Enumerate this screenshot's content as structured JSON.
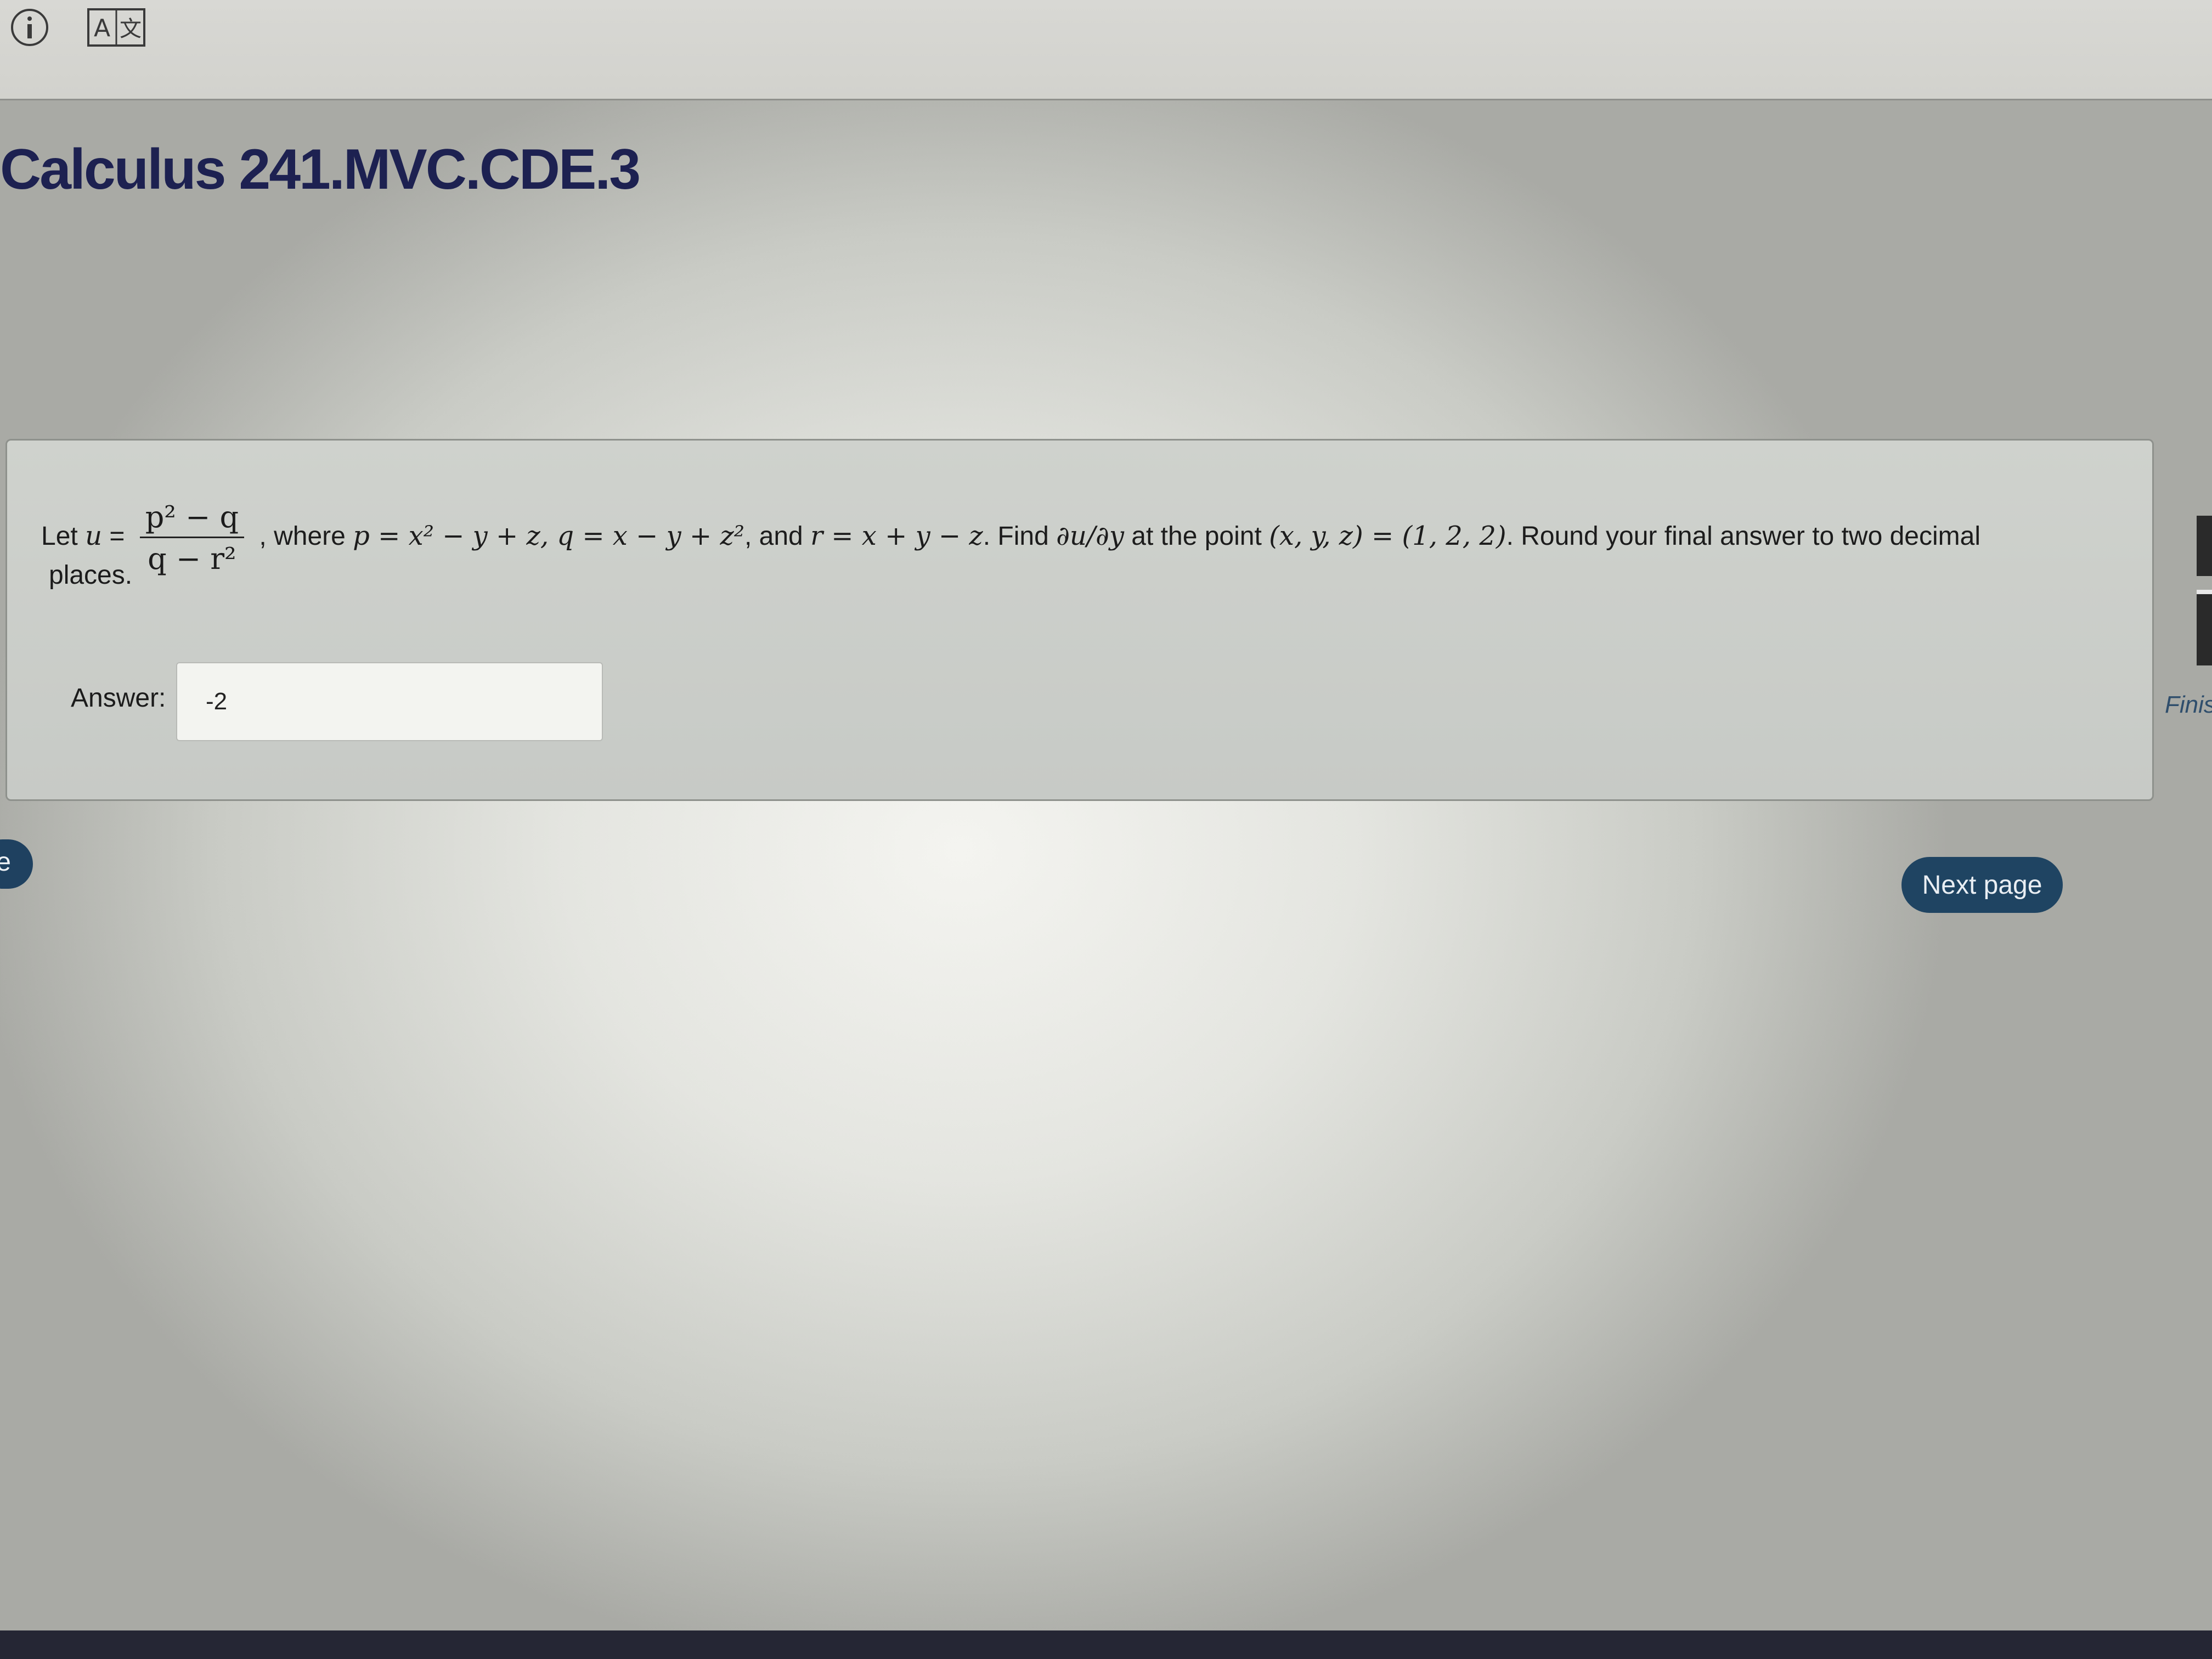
{
  "toolbar": {
    "icons": [
      "info-icon",
      "translate-icon"
    ],
    "translate_glyph": "A文"
  },
  "page": {
    "title": "Calculus 241.MVC.CDE.3"
  },
  "question": {
    "intro": "Let",
    "var_u": "u",
    "equals": "=",
    "fraction_numerator": "p² − q",
    "fraction_denominator": "q − r²",
    "where_text": ", where",
    "p_def": "p = x² − y + z, q = x − y + z²",
    "and_text": ", and",
    "r_def": "r = x + y − z",
    "find_text": ". Find",
    "derivative": "∂u/∂y",
    "point_text": "at the point",
    "point_def": "(x, y, z) = (1, 2, 2)",
    "round_text": ". Round your final answer to two decimal",
    "places_text": "places."
  },
  "answer": {
    "label": "Answer:",
    "value": "-2"
  },
  "navigation": {
    "prev_fragment": "e",
    "next_label": "Next page",
    "finish_fragment": "Finis"
  }
}
